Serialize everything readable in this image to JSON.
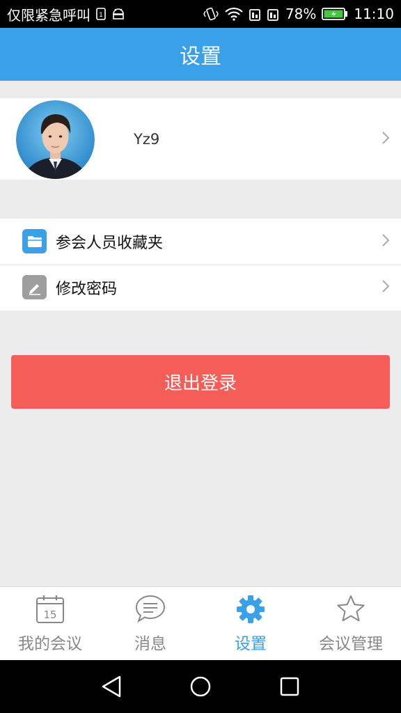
{
  "status_bar": {
    "carrier_text": "仅限紧急呼叫",
    "sim_slot": "1",
    "battery_percent": "78%",
    "time": "11:10"
  },
  "header": {
    "title": "设置"
  },
  "profile": {
    "username": "Yz9"
  },
  "menu": {
    "items": [
      {
        "label": "参会人员收藏夹",
        "icon": "folder-icon",
        "color": "#3aa0e8"
      },
      {
        "label": "修改密码",
        "icon": "edit-icon",
        "color": "#9e9e9e"
      }
    ]
  },
  "logout": {
    "label": "退出登录",
    "color": "#f45d58"
  },
  "tabbar": {
    "tabs": [
      {
        "label": "我的会议",
        "icon": "calendar-icon",
        "icon_text": "15",
        "active": false
      },
      {
        "label": "消息",
        "icon": "message-icon",
        "active": false
      },
      {
        "label": "设置",
        "icon": "gear-icon",
        "active": true
      },
      {
        "label": "会议管理",
        "icon": "star-icon",
        "active": false
      }
    ]
  },
  "colors": {
    "accent": "#3aa0e8",
    "inactive": "#888888",
    "background": "#ececec"
  }
}
